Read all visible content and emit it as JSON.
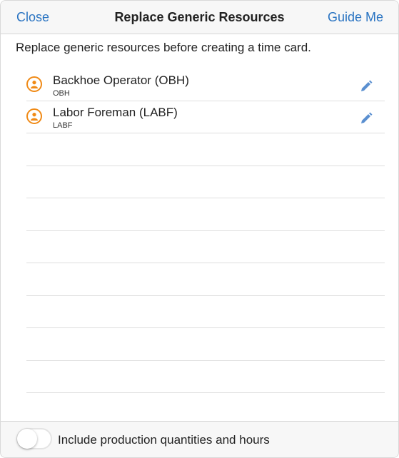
{
  "header": {
    "close_label": "Close",
    "title": "Replace Generic Resources",
    "guide_label": "Guide Me"
  },
  "instruction": "Replace generic resources before creating a time card.",
  "resources": [
    {
      "name": "Backhoe Operator (OBH)",
      "code": "OBH",
      "icon": "person-icon"
    },
    {
      "name": "Labor Foreman (LABF)",
      "code": "LABF",
      "icon": "person-icon"
    }
  ],
  "footer": {
    "toggle_label": "Include production quantities and hours",
    "toggle_on": false
  },
  "colors": {
    "accent": "#2a74c2",
    "avatar": "#f08a16",
    "edit_icon": "#5a8fd0"
  }
}
